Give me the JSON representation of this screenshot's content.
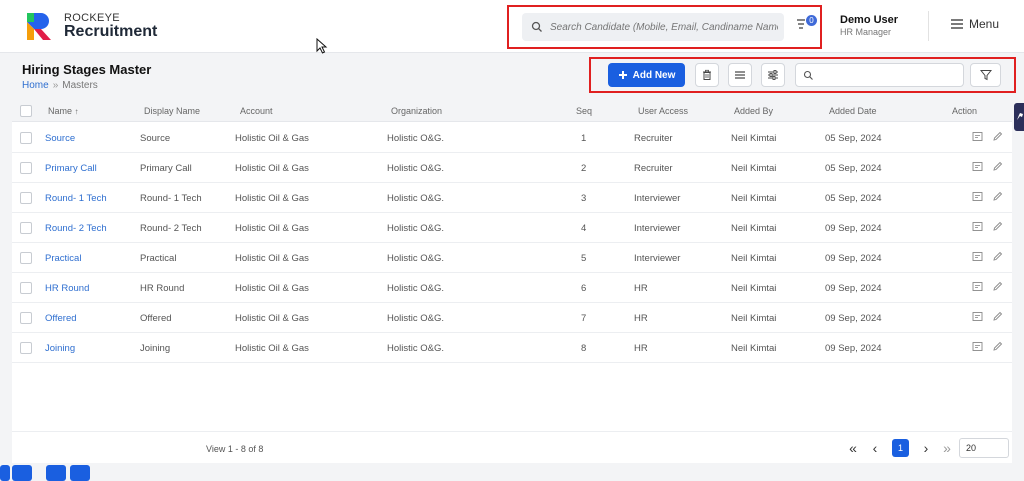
{
  "header": {
    "brand_top": "ROCKEYE",
    "brand_main": "Recruitment",
    "search_placeholder": "Search Candidate (Mobile, Email, Candiname Name)",
    "filter_count": "0",
    "user_name": "Demo User",
    "user_role": "HR Manager",
    "menu_label": "Menu"
  },
  "page": {
    "title": "Hiring Stages Master",
    "breadcrumb": [
      "Home",
      "Masters"
    ]
  },
  "toolbar": {
    "add_label": "Add New",
    "search_value": ""
  },
  "table": {
    "columns": [
      "Name",
      "Display Name",
      "Account",
      "Organization",
      "Seq",
      "User Access",
      "Added By",
      "Added Date",
      "Action"
    ],
    "rows": [
      {
        "name": "Source",
        "display": "Source",
        "account": "Holistic Oil & Gas",
        "org": "Holistic O&G.",
        "seq": "1",
        "access": "Recruiter",
        "by": "Neil Kimtai",
        "date": "05 Sep, 2024"
      },
      {
        "name": "Primary Call",
        "display": "Primary Call",
        "account": "Holistic Oil & Gas",
        "org": "Holistic O&G.",
        "seq": "2",
        "access": "Recruiter",
        "by": "Neil Kimtai",
        "date": "05 Sep, 2024"
      },
      {
        "name": "Round- 1 Tech",
        "display": "Round- 1 Tech",
        "account": "Holistic Oil & Gas",
        "org": "Holistic O&G.",
        "seq": "3",
        "access": "Interviewer",
        "by": "Neil Kimtai",
        "date": "05 Sep, 2024"
      },
      {
        "name": "Round- 2 Tech",
        "display": "Round- 2 Tech",
        "account": "Holistic Oil & Gas",
        "org": "Holistic O&G.",
        "seq": "4",
        "access": "Interviewer",
        "by": "Neil Kimtai",
        "date": "09 Sep, 2024"
      },
      {
        "name": "Practical",
        "display": "Practical",
        "account": "Holistic Oil & Gas",
        "org": "Holistic O&G.",
        "seq": "5",
        "access": "Interviewer",
        "by": "Neil Kimtai",
        "date": "09 Sep, 2024"
      },
      {
        "name": "HR Round",
        "display": "HR Round",
        "account": "Holistic Oil & Gas",
        "org": "Holistic O&G.",
        "seq": "6",
        "access": "HR",
        "by": "Neil Kimtai",
        "date": "09 Sep, 2024"
      },
      {
        "name": "Offered",
        "display": "Offered",
        "account": "Holistic Oil & Gas",
        "org": "Holistic O&G.",
        "seq": "7",
        "access": "HR",
        "by": "Neil Kimtai",
        "date": "09 Sep, 2024"
      },
      {
        "name": "Joining",
        "display": "Joining",
        "account": "Holistic Oil & Gas",
        "org": "Holistic O&G.",
        "seq": "8",
        "access": "HR",
        "by": "Neil Kimtai",
        "date": "09 Sep, 2024"
      }
    ]
  },
  "pagination": {
    "view_text": "View 1 - 8 of 8",
    "current_page": "1",
    "page_size": "20"
  },
  "colors": {
    "primary": "#1a5fe0",
    "link": "#2f6fd0",
    "highlight": "#e02020"
  }
}
